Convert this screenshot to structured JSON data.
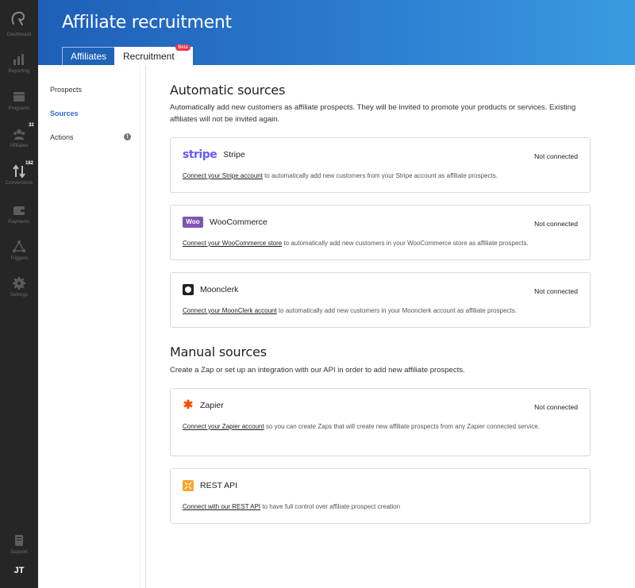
{
  "rail": {
    "items": [
      {
        "label": "Dashboard",
        "icon": "dashboard-icon"
      },
      {
        "label": "Reporting",
        "icon": "reporting-icon"
      },
      {
        "label": "Programs",
        "icon": "programs-icon"
      },
      {
        "label": "Affiliates",
        "icon": "affiliates-icon",
        "badge": "32"
      },
      {
        "label": "Conversions",
        "icon": "conversions-icon",
        "badge": "182"
      },
      {
        "label": "Payments",
        "icon": "payments-icon"
      },
      {
        "label": "Triggers",
        "icon": "triggers-icon"
      },
      {
        "label": "Settings",
        "icon": "settings-icon"
      }
    ],
    "support_label": "Support",
    "avatar_initials": "JT"
  },
  "header": {
    "title": "Affiliate recruitment",
    "tabs": [
      {
        "label": "Affiliates"
      },
      {
        "label": "Recruitment",
        "badge": "Beta"
      }
    ]
  },
  "subnav": {
    "items": [
      {
        "label": "Prospects"
      },
      {
        "label": "Sources"
      },
      {
        "label": "Actions",
        "alert": "!"
      }
    ]
  },
  "automatic": {
    "title": "Automatic sources",
    "description": "Automatically add new customers as affiliate prospects. They will be invited to promote your products or services. Existing affiliates will not be invited again.",
    "sources": [
      {
        "name": "Stripe",
        "logo_text": "stripe",
        "status": "Not connected",
        "link": "Connect your Stripe account",
        "text": " to automatically add new customers from your Stripe account as affiliate prospects."
      },
      {
        "name": "WooCommerce",
        "logo_text": "Woo",
        "status": "Not connected",
        "link": "Connect your WooCommerce store",
        "text": " to automatically add new customers in your WooCommerce store as affiliate prospects."
      },
      {
        "name": "Moonclerk",
        "status": "Not connected",
        "link": "Connect your MoonClerk account",
        "text": " to automatically add new customers in your Moonclerk account as affiliate prospects."
      }
    ]
  },
  "manual": {
    "title": "Manual sources",
    "description": "Create a Zap or set up an integration with our API in order to add new affiliate prospects.",
    "sources": [
      {
        "name": "Zapier",
        "status": "Not connected",
        "link": "Connect your Zapier account",
        "text": " so you can create Zaps that will create new affiliate prospects from any Zapier connected service."
      },
      {
        "name": "REST API",
        "link": "Connect with our REST API",
        "text": " to have full control over affiliate prospect creation"
      }
    ]
  },
  "colors": {
    "accent": "#2a6fd1",
    "rail_bg": "#262626",
    "header_start": "#1e5fb8",
    "header_end": "#3a9be0",
    "beta": "#e8394b"
  }
}
